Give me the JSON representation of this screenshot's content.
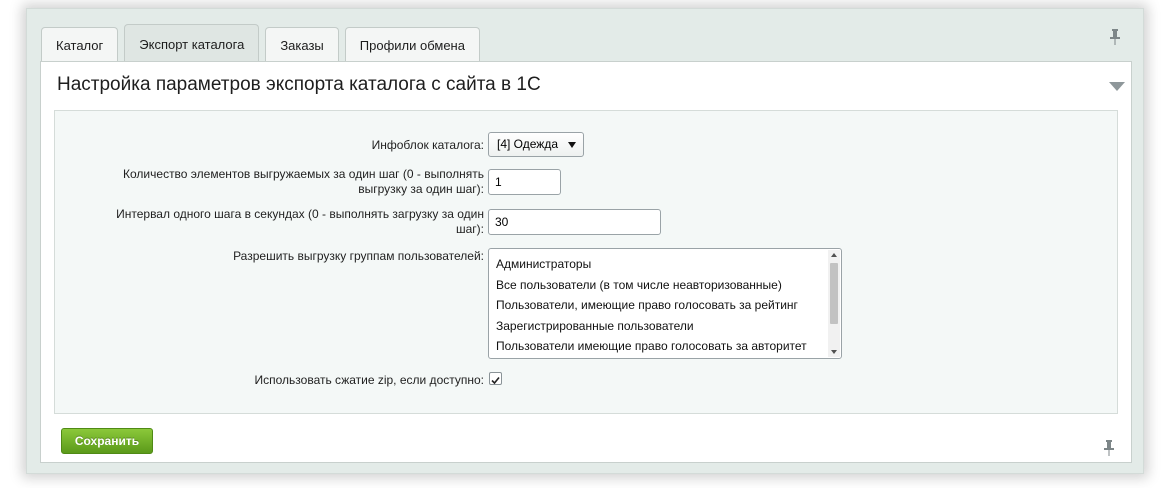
{
  "tabs": [
    {
      "label": "Каталог",
      "active": false
    },
    {
      "label": "Экспорт каталога",
      "active": true
    },
    {
      "label": "Заказы",
      "active": false
    },
    {
      "label": "Профили обмена",
      "active": false
    }
  ],
  "panel": {
    "title": "Настройка параметров экспорта каталога с сайта в 1С"
  },
  "form": {
    "iblock": {
      "label": "Инфоблок каталога:",
      "value": "[4] Одежда"
    },
    "elements_per_step": {
      "label_line1": "Количество элементов выгружаемых за один шаг (0 - выполнять",
      "label_line2": "выгрузку за один шаг):",
      "value": "1"
    },
    "step_interval": {
      "label_line1": "Интервал одного шага в секундах (0 - выполнять загрузку за один",
      "label_line2": "шаг):",
      "value": "30"
    },
    "user_groups": {
      "label": "Разрешить выгрузку группам пользователей:",
      "options": [
        "Администраторы",
        "Все пользователи (в том числе неавторизованные)",
        "Пользователи, имеющие право голосовать за рейтинг",
        "Зарегистрированные пользователи",
        "Пользователи имеющие право голосовать за авторитет"
      ]
    },
    "use_zip": {
      "label": "Использовать сжатие zip, если доступно:",
      "checked": true
    }
  },
  "footer": {
    "save_label": "Сохранить"
  },
  "colors": {
    "save_button": "#6aab24",
    "frame_bg": "#e3ebe8"
  }
}
